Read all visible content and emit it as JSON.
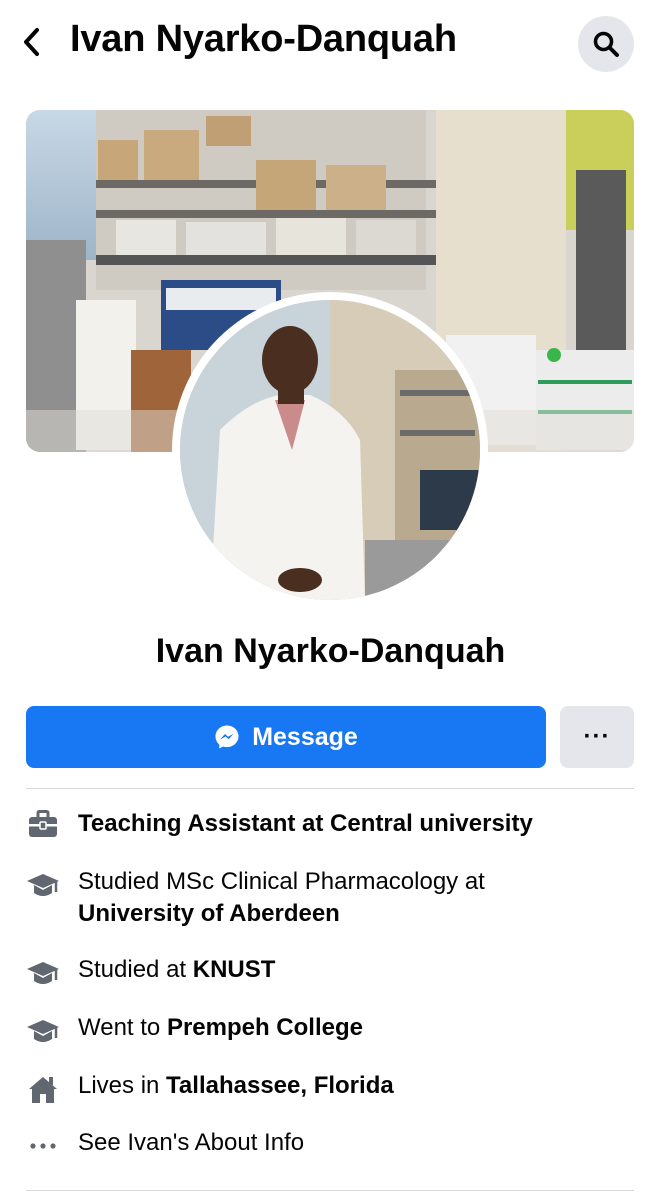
{
  "header": {
    "title": "Ivan Nyarko-Danquah",
    "back_icon": "chevron-left-icon",
    "search_icon": "search-icon"
  },
  "profile": {
    "name": "Ivan Nyarko-Danquah"
  },
  "actions": {
    "message_label": "Message",
    "more_label": "···"
  },
  "intro": {
    "work": {
      "icon": "briefcase-icon",
      "text": "Teaching Assistant at Central university"
    },
    "education_1": {
      "icon": "graduation-cap-icon",
      "prefix": "Studied MSc Clinical Pharmacology at",
      "place": "University of Aberdeen"
    },
    "education_2": {
      "icon": "graduation-cap-icon",
      "prefix": "Studied at",
      "place": "KNUST"
    },
    "education_3": {
      "icon": "graduation-cap-icon",
      "prefix": "Went to",
      "place": "Prempeh College"
    },
    "residence": {
      "icon": "home-icon",
      "prefix": "Lives in",
      "place": "Tallahassee, Florida"
    },
    "about_link": {
      "icon": "more-dots-icon",
      "text": "See Ivan's About Info"
    }
  },
  "colors": {
    "accent": "#1877f2",
    "button_grey": "#e4e6eb",
    "icon_grey": "#606770"
  }
}
